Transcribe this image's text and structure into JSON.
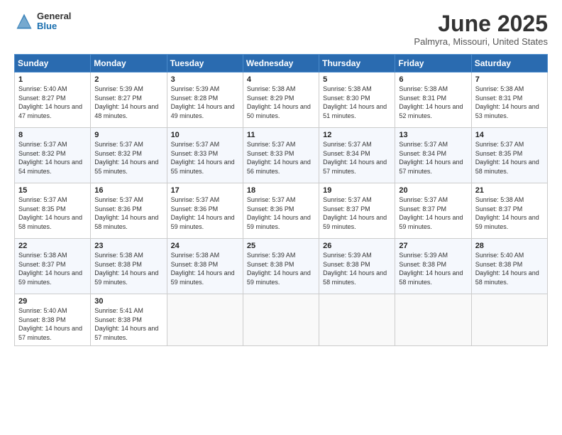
{
  "header": {
    "logo_general": "General",
    "logo_blue": "Blue",
    "month_title": "June 2025",
    "location": "Palmyra, Missouri, United States"
  },
  "days_of_week": [
    "Sunday",
    "Monday",
    "Tuesday",
    "Wednesday",
    "Thursday",
    "Friday",
    "Saturday"
  ],
  "weeks": [
    [
      {
        "day": "1",
        "sunrise": "Sunrise: 5:40 AM",
        "sunset": "Sunset: 8:27 PM",
        "daylight": "Daylight: 14 hours and 47 minutes."
      },
      {
        "day": "2",
        "sunrise": "Sunrise: 5:39 AM",
        "sunset": "Sunset: 8:27 PM",
        "daylight": "Daylight: 14 hours and 48 minutes."
      },
      {
        "day": "3",
        "sunrise": "Sunrise: 5:39 AM",
        "sunset": "Sunset: 8:28 PM",
        "daylight": "Daylight: 14 hours and 49 minutes."
      },
      {
        "day": "4",
        "sunrise": "Sunrise: 5:38 AM",
        "sunset": "Sunset: 8:29 PM",
        "daylight": "Daylight: 14 hours and 50 minutes."
      },
      {
        "day": "5",
        "sunrise": "Sunrise: 5:38 AM",
        "sunset": "Sunset: 8:30 PM",
        "daylight": "Daylight: 14 hours and 51 minutes."
      },
      {
        "day": "6",
        "sunrise": "Sunrise: 5:38 AM",
        "sunset": "Sunset: 8:31 PM",
        "daylight": "Daylight: 14 hours and 52 minutes."
      },
      {
        "day": "7",
        "sunrise": "Sunrise: 5:38 AM",
        "sunset": "Sunset: 8:31 PM",
        "daylight": "Daylight: 14 hours and 53 minutes."
      }
    ],
    [
      {
        "day": "8",
        "sunrise": "Sunrise: 5:37 AM",
        "sunset": "Sunset: 8:32 PM",
        "daylight": "Daylight: 14 hours and 54 minutes."
      },
      {
        "day": "9",
        "sunrise": "Sunrise: 5:37 AM",
        "sunset": "Sunset: 8:32 PM",
        "daylight": "Daylight: 14 hours and 55 minutes."
      },
      {
        "day": "10",
        "sunrise": "Sunrise: 5:37 AM",
        "sunset": "Sunset: 8:33 PM",
        "daylight": "Daylight: 14 hours and 55 minutes."
      },
      {
        "day": "11",
        "sunrise": "Sunrise: 5:37 AM",
        "sunset": "Sunset: 8:33 PM",
        "daylight": "Daylight: 14 hours and 56 minutes."
      },
      {
        "day": "12",
        "sunrise": "Sunrise: 5:37 AM",
        "sunset": "Sunset: 8:34 PM",
        "daylight": "Daylight: 14 hours and 57 minutes."
      },
      {
        "day": "13",
        "sunrise": "Sunrise: 5:37 AM",
        "sunset": "Sunset: 8:34 PM",
        "daylight": "Daylight: 14 hours and 57 minutes."
      },
      {
        "day": "14",
        "sunrise": "Sunrise: 5:37 AM",
        "sunset": "Sunset: 8:35 PM",
        "daylight": "Daylight: 14 hours and 58 minutes."
      }
    ],
    [
      {
        "day": "15",
        "sunrise": "Sunrise: 5:37 AM",
        "sunset": "Sunset: 8:35 PM",
        "daylight": "Daylight: 14 hours and 58 minutes."
      },
      {
        "day": "16",
        "sunrise": "Sunrise: 5:37 AM",
        "sunset": "Sunset: 8:36 PM",
        "daylight": "Daylight: 14 hours and 58 minutes."
      },
      {
        "day": "17",
        "sunrise": "Sunrise: 5:37 AM",
        "sunset": "Sunset: 8:36 PM",
        "daylight": "Daylight: 14 hours and 59 minutes."
      },
      {
        "day": "18",
        "sunrise": "Sunrise: 5:37 AM",
        "sunset": "Sunset: 8:36 PM",
        "daylight": "Daylight: 14 hours and 59 minutes."
      },
      {
        "day": "19",
        "sunrise": "Sunrise: 5:37 AM",
        "sunset": "Sunset: 8:37 PM",
        "daylight": "Daylight: 14 hours and 59 minutes."
      },
      {
        "day": "20",
        "sunrise": "Sunrise: 5:37 AM",
        "sunset": "Sunset: 8:37 PM",
        "daylight": "Daylight: 14 hours and 59 minutes."
      },
      {
        "day": "21",
        "sunrise": "Sunrise: 5:38 AM",
        "sunset": "Sunset: 8:37 PM",
        "daylight": "Daylight: 14 hours and 59 minutes."
      }
    ],
    [
      {
        "day": "22",
        "sunrise": "Sunrise: 5:38 AM",
        "sunset": "Sunset: 8:37 PM",
        "daylight": "Daylight: 14 hours and 59 minutes."
      },
      {
        "day": "23",
        "sunrise": "Sunrise: 5:38 AM",
        "sunset": "Sunset: 8:38 PM",
        "daylight": "Daylight: 14 hours and 59 minutes."
      },
      {
        "day": "24",
        "sunrise": "Sunrise: 5:38 AM",
        "sunset": "Sunset: 8:38 PM",
        "daylight": "Daylight: 14 hours and 59 minutes."
      },
      {
        "day": "25",
        "sunrise": "Sunrise: 5:39 AM",
        "sunset": "Sunset: 8:38 PM",
        "daylight": "Daylight: 14 hours and 59 minutes."
      },
      {
        "day": "26",
        "sunrise": "Sunrise: 5:39 AM",
        "sunset": "Sunset: 8:38 PM",
        "daylight": "Daylight: 14 hours and 58 minutes."
      },
      {
        "day": "27",
        "sunrise": "Sunrise: 5:39 AM",
        "sunset": "Sunset: 8:38 PM",
        "daylight": "Daylight: 14 hours and 58 minutes."
      },
      {
        "day": "28",
        "sunrise": "Sunrise: 5:40 AM",
        "sunset": "Sunset: 8:38 PM",
        "daylight": "Daylight: 14 hours and 58 minutes."
      }
    ],
    [
      {
        "day": "29",
        "sunrise": "Sunrise: 5:40 AM",
        "sunset": "Sunset: 8:38 PM",
        "daylight": "Daylight: 14 hours and 57 minutes."
      },
      {
        "day": "30",
        "sunrise": "Sunrise: 5:41 AM",
        "sunset": "Sunset: 8:38 PM",
        "daylight": "Daylight: 14 hours and 57 minutes."
      },
      null,
      null,
      null,
      null,
      null
    ]
  ]
}
